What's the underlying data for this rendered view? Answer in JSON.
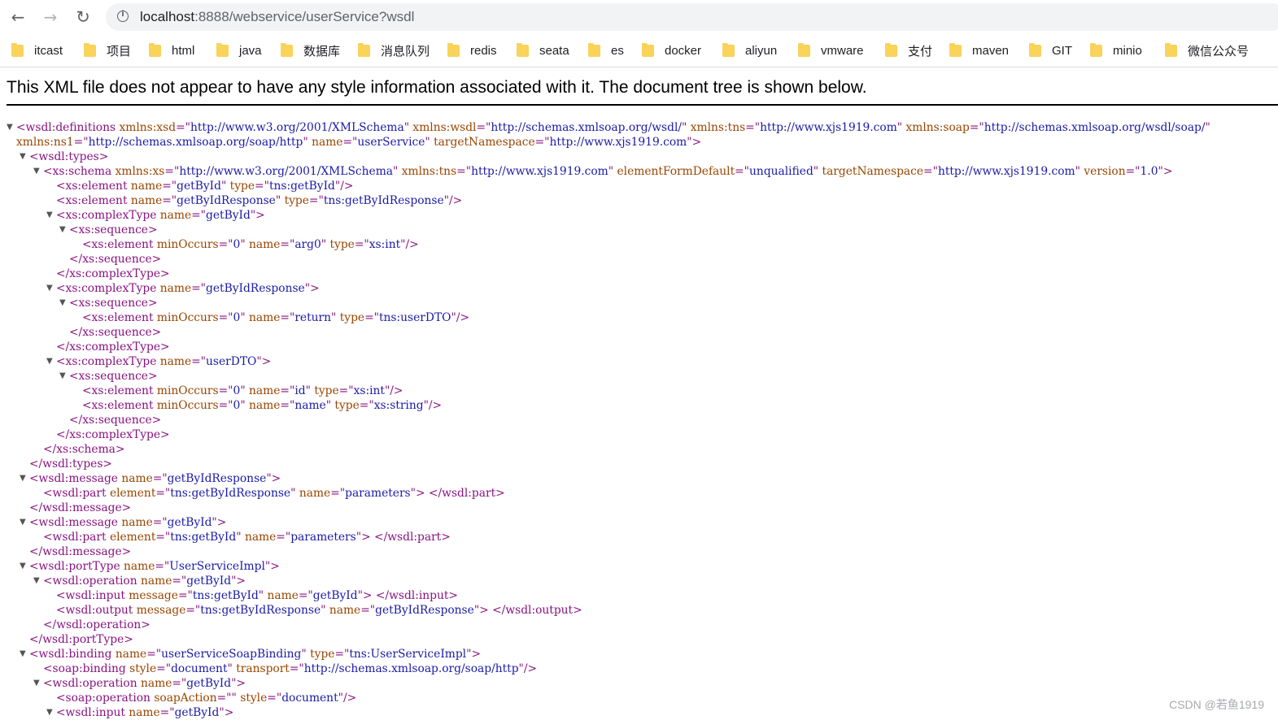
{
  "browser": {
    "url_host": "localhost",
    "url_path": ":8888/webservice/userService?wsdl"
  },
  "bookmarks": [
    "itcast",
    "项目",
    "html",
    "java",
    "数据库",
    "消息队列",
    "redis",
    "seata",
    "es",
    "docker",
    "aliyun",
    "vmware",
    "支付",
    "maven",
    "GIT",
    "minio",
    "微信公众号"
  ],
  "xml_viewer": {
    "notice": "This XML file does not appear to have any style information associated with it. The document tree is shown below.",
    "lines": [
      {
        "toggle": true,
        "tokens": [
          [
            "t",
            "<wsdl:definitions "
          ],
          [
            "n",
            "xmlns:xsd"
          ],
          [
            "t",
            "=\""
          ],
          [
            "v",
            "http://www.w3.org/2001/XMLSchema"
          ],
          [
            "t",
            "\" "
          ],
          [
            "n",
            "xmlns:wsdl"
          ],
          [
            "t",
            "=\""
          ],
          [
            "v",
            "http://schemas.xmlsoap.org/wsdl/"
          ],
          [
            "t",
            "\" "
          ],
          [
            "n",
            "xmlns:tns"
          ],
          [
            "t",
            "=\""
          ],
          [
            "v",
            "http://www.xjs1919.com"
          ],
          [
            "t",
            "\" "
          ],
          [
            "n",
            "xmlns:soap"
          ],
          [
            "t",
            "=\""
          ],
          [
            "v",
            "http://schemas.xmlsoap.org/wsdl/soap/"
          ],
          [
            "t",
            "\""
          ]
        ]
      },
      {
        "toggle": false,
        "tokens": [
          [
            "n",
            "xmlns:ns1"
          ],
          [
            "t",
            "=\""
          ],
          [
            "v",
            "http://schemas.xmlsoap.org/soap/http"
          ],
          [
            "t",
            "\" "
          ],
          [
            "n",
            "name"
          ],
          [
            "t",
            "=\""
          ],
          [
            "v",
            "userService"
          ],
          [
            "t",
            "\" "
          ],
          [
            "n",
            "targetNamespace"
          ],
          [
            "t",
            "=\""
          ],
          [
            "v",
            "http://www.xjs1919.com"
          ],
          [
            "t",
            "\">"
          ]
        ]
      },
      {
        "toggle": true,
        "tokens": [
          [
            "t",
            "<wsdl:types>"
          ]
        ]
      },
      {
        "toggle": true,
        "tokens": [
          [
            "t",
            "<xs:schema "
          ],
          [
            "n",
            "xmlns:xs"
          ],
          [
            "t",
            "=\""
          ],
          [
            "v",
            "http://www.w3.org/2001/XMLSchema"
          ],
          [
            "t",
            "\" "
          ],
          [
            "n",
            "xmlns:tns"
          ],
          [
            "t",
            "=\""
          ],
          [
            "v",
            "http://www.xjs1919.com"
          ],
          [
            "t",
            "\" "
          ],
          [
            "n",
            "elementFormDefault"
          ],
          [
            "t",
            "=\""
          ],
          [
            "v",
            "unqualified"
          ],
          [
            "t",
            "\" "
          ],
          [
            "n",
            "targetNamespace"
          ],
          [
            "t",
            "=\""
          ],
          [
            "v",
            "http://www.xjs1919.com"
          ],
          [
            "t",
            "\" "
          ],
          [
            "n",
            "version"
          ],
          [
            "t",
            "=\""
          ],
          [
            "v",
            "1.0"
          ],
          [
            "t",
            "\">"
          ]
        ]
      },
      {
        "toggle": false,
        "tokens": [
          [
            "t",
            "<xs:element "
          ],
          [
            "n",
            "name"
          ],
          [
            "t",
            "=\""
          ],
          [
            "v",
            "getById"
          ],
          [
            "t",
            "\" "
          ],
          [
            "n",
            "type"
          ],
          [
            "t",
            "=\""
          ],
          [
            "v",
            "tns:getById"
          ],
          [
            "t",
            "\"/>"
          ]
        ]
      },
      {
        "toggle": false,
        "tokens": [
          [
            "t",
            "<xs:element "
          ],
          [
            "n",
            "name"
          ],
          [
            "t",
            "=\""
          ],
          [
            "v",
            "getByIdResponse"
          ],
          [
            "t",
            "\" "
          ],
          [
            "n",
            "type"
          ],
          [
            "t",
            "=\""
          ],
          [
            "v",
            "tns:getByIdResponse"
          ],
          [
            "t",
            "\"/>"
          ]
        ]
      },
      {
        "toggle": true,
        "tokens": [
          [
            "t",
            "<xs:complexType "
          ],
          [
            "n",
            "name"
          ],
          [
            "t",
            "=\""
          ],
          [
            "v",
            "getById"
          ],
          [
            "t",
            "\">"
          ]
        ]
      },
      {
        "toggle": true,
        "tokens": [
          [
            "t",
            "<xs:sequence>"
          ]
        ]
      },
      {
        "toggle": false,
        "tokens": [
          [
            "t",
            "<xs:element "
          ],
          [
            "n",
            "minOccurs"
          ],
          [
            "t",
            "=\""
          ],
          [
            "v",
            "0"
          ],
          [
            "t",
            "\" "
          ],
          [
            "n",
            "name"
          ],
          [
            "t",
            "=\""
          ],
          [
            "v",
            "arg0"
          ],
          [
            "t",
            "\" "
          ],
          [
            "n",
            "type"
          ],
          [
            "t",
            "=\""
          ],
          [
            "v",
            "xs:int"
          ],
          [
            "t",
            "\"/>"
          ]
        ]
      },
      {
        "toggle": false,
        "tokens": [
          [
            "t",
            "</xs:sequence>"
          ]
        ]
      },
      {
        "toggle": false,
        "tokens": [
          [
            "t",
            "</xs:complexType>"
          ]
        ]
      },
      {
        "toggle": true,
        "tokens": [
          [
            "t",
            "<xs:complexType "
          ],
          [
            "n",
            "name"
          ],
          [
            "t",
            "=\""
          ],
          [
            "v",
            "getByIdResponse"
          ],
          [
            "t",
            "\">"
          ]
        ]
      },
      {
        "toggle": true,
        "tokens": [
          [
            "t",
            "<xs:sequence>"
          ]
        ]
      },
      {
        "toggle": false,
        "tokens": [
          [
            "t",
            "<xs:element "
          ],
          [
            "n",
            "minOccurs"
          ],
          [
            "t",
            "=\""
          ],
          [
            "v",
            "0"
          ],
          [
            "t",
            "\" "
          ],
          [
            "n",
            "name"
          ],
          [
            "t",
            "=\""
          ],
          [
            "v",
            "return"
          ],
          [
            "t",
            "\" "
          ],
          [
            "n",
            "type"
          ],
          [
            "t",
            "=\""
          ],
          [
            "v",
            "tns:userDTO"
          ],
          [
            "t",
            "\"/>"
          ]
        ]
      },
      {
        "toggle": false,
        "tokens": [
          [
            "t",
            "</xs:sequence>"
          ]
        ]
      },
      {
        "toggle": false,
        "tokens": [
          [
            "t",
            "</xs:complexType>"
          ]
        ]
      },
      {
        "toggle": true,
        "tokens": [
          [
            "t",
            "<xs:complexType "
          ],
          [
            "n",
            "name"
          ],
          [
            "t",
            "=\""
          ],
          [
            "v",
            "userDTO"
          ],
          [
            "t",
            "\">"
          ]
        ]
      },
      {
        "toggle": true,
        "tokens": [
          [
            "t",
            "<xs:sequence>"
          ]
        ]
      },
      {
        "toggle": false,
        "tokens": [
          [
            "t",
            "<xs:element "
          ],
          [
            "n",
            "minOccurs"
          ],
          [
            "t",
            "=\""
          ],
          [
            "v",
            "0"
          ],
          [
            "t",
            "\" "
          ],
          [
            "n",
            "name"
          ],
          [
            "t",
            "=\""
          ],
          [
            "v",
            "id"
          ],
          [
            "t",
            "\" "
          ],
          [
            "n",
            "type"
          ],
          [
            "t",
            "=\""
          ],
          [
            "v",
            "xs:int"
          ],
          [
            "t",
            "\"/>"
          ]
        ]
      },
      {
        "toggle": false,
        "tokens": [
          [
            "t",
            "<xs:element "
          ],
          [
            "n",
            "minOccurs"
          ],
          [
            "t",
            "=\""
          ],
          [
            "v",
            "0"
          ],
          [
            "t",
            "\" "
          ],
          [
            "n",
            "name"
          ],
          [
            "t",
            "=\""
          ],
          [
            "v",
            "name"
          ],
          [
            "t",
            "\" "
          ],
          [
            "n",
            "type"
          ],
          [
            "t",
            "=\""
          ],
          [
            "v",
            "xs:string"
          ],
          [
            "t",
            "\"/>"
          ]
        ]
      },
      {
        "toggle": false,
        "tokens": [
          [
            "t",
            "</xs:sequence>"
          ]
        ]
      },
      {
        "toggle": false,
        "tokens": [
          [
            "t",
            "</xs:complexType>"
          ]
        ]
      },
      {
        "toggle": false,
        "tokens": [
          [
            "t",
            "</xs:schema>"
          ]
        ]
      },
      {
        "toggle": false,
        "tokens": [
          [
            "t",
            "</wsdl:types>"
          ]
        ]
      },
      {
        "toggle": true,
        "tokens": [
          [
            "t",
            "<wsdl:message "
          ],
          [
            "n",
            "name"
          ],
          [
            "t",
            "=\""
          ],
          [
            "v",
            "getByIdResponse"
          ],
          [
            "t",
            "\">"
          ]
        ]
      },
      {
        "toggle": false,
        "tokens": [
          [
            "t",
            "<wsdl:part "
          ],
          [
            "n",
            "element"
          ],
          [
            "t",
            "=\""
          ],
          [
            "v",
            "tns:getByIdResponse"
          ],
          [
            "t",
            "\" "
          ],
          [
            "n",
            "name"
          ],
          [
            "t",
            "=\""
          ],
          [
            "v",
            "parameters"
          ],
          [
            "t",
            "\"> </wsdl:part>"
          ]
        ]
      },
      {
        "toggle": false,
        "tokens": [
          [
            "t",
            "</wsdl:message>"
          ]
        ]
      },
      {
        "toggle": true,
        "tokens": [
          [
            "t",
            "<wsdl:message "
          ],
          [
            "n",
            "name"
          ],
          [
            "t",
            "=\""
          ],
          [
            "v",
            "getById"
          ],
          [
            "t",
            "\">"
          ]
        ]
      },
      {
        "toggle": false,
        "tokens": [
          [
            "t",
            "<wsdl:part "
          ],
          [
            "n",
            "element"
          ],
          [
            "t",
            "=\""
          ],
          [
            "v",
            "tns:getById"
          ],
          [
            "t",
            "\" "
          ],
          [
            "n",
            "name"
          ],
          [
            "t",
            "=\""
          ],
          [
            "v",
            "parameters"
          ],
          [
            "t",
            "\"> </wsdl:part>"
          ]
        ]
      },
      {
        "toggle": false,
        "tokens": [
          [
            "t",
            "</wsdl:message>"
          ]
        ]
      },
      {
        "toggle": true,
        "tokens": [
          [
            "t",
            "<wsdl:portType "
          ],
          [
            "n",
            "name"
          ],
          [
            "t",
            "=\""
          ],
          [
            "v",
            "UserServiceImpl"
          ],
          [
            "t",
            "\">"
          ]
        ]
      },
      {
        "toggle": true,
        "tokens": [
          [
            "t",
            "<wsdl:operation "
          ],
          [
            "n",
            "name"
          ],
          [
            "t",
            "=\""
          ],
          [
            "v",
            "getById"
          ],
          [
            "t",
            "\">"
          ]
        ]
      },
      {
        "toggle": false,
        "tokens": [
          [
            "t",
            "<wsdl:input "
          ],
          [
            "n",
            "message"
          ],
          [
            "t",
            "=\""
          ],
          [
            "v",
            "tns:getById"
          ],
          [
            "t",
            "\" "
          ],
          [
            "n",
            "name"
          ],
          [
            "t",
            "=\""
          ],
          [
            "v",
            "getById"
          ],
          [
            "t",
            "\"> </wsdl:input>"
          ]
        ]
      },
      {
        "toggle": false,
        "tokens": [
          [
            "t",
            "<wsdl:output "
          ],
          [
            "n",
            "message"
          ],
          [
            "t",
            "=\""
          ],
          [
            "v",
            "tns:getByIdResponse"
          ],
          [
            "t",
            "\" "
          ],
          [
            "n",
            "name"
          ],
          [
            "t",
            "=\""
          ],
          [
            "v",
            "getByIdResponse"
          ],
          [
            "t",
            "\"> </wsdl:output>"
          ]
        ]
      },
      {
        "toggle": false,
        "tokens": [
          [
            "t",
            "</wsdl:operation>"
          ]
        ]
      },
      {
        "toggle": false,
        "tokens": [
          [
            "t",
            "</wsdl:portType>"
          ]
        ]
      },
      {
        "toggle": true,
        "tokens": [
          [
            "t",
            "<wsdl:binding "
          ],
          [
            "n",
            "name"
          ],
          [
            "t",
            "=\""
          ],
          [
            "v",
            "userServiceSoapBinding"
          ],
          [
            "t",
            "\" "
          ],
          [
            "n",
            "type"
          ],
          [
            "t",
            "=\""
          ],
          [
            "v",
            "tns:UserServiceImpl"
          ],
          [
            "t",
            "\">"
          ]
        ]
      },
      {
        "toggle": false,
        "tokens": [
          [
            "t",
            "<soap:binding "
          ],
          [
            "n",
            "style"
          ],
          [
            "t",
            "=\""
          ],
          [
            "v",
            "document"
          ],
          [
            "t",
            "\" "
          ],
          [
            "n",
            "transport"
          ],
          [
            "t",
            "=\""
          ],
          [
            "v",
            "http://schemas.xmlsoap.org/soap/http"
          ],
          [
            "t",
            "\"/>"
          ]
        ]
      },
      {
        "toggle": true,
        "tokens": [
          [
            "t",
            "<wsdl:operation "
          ],
          [
            "n",
            "name"
          ],
          [
            "t",
            "=\""
          ],
          [
            "v",
            "getById"
          ],
          [
            "t",
            "\">"
          ]
        ]
      },
      {
        "toggle": false,
        "tokens": [
          [
            "t",
            "<soap:operation "
          ],
          [
            "n",
            "soapAction"
          ],
          [
            "t",
            "=\""
          ],
          [
            "v",
            ""
          ],
          [
            "t",
            "\" "
          ],
          [
            "n",
            "style"
          ],
          [
            "t",
            "=\""
          ],
          [
            "v",
            "document"
          ],
          [
            "t",
            "\"/>"
          ]
        ]
      },
      {
        "toggle": true,
        "tokens": [
          [
            "t",
            "<wsdl:input "
          ],
          [
            "n",
            "name"
          ],
          [
            "t",
            "=\""
          ],
          [
            "v",
            "getById"
          ],
          [
            "t",
            "\">"
          ]
        ]
      }
    ]
  },
  "watermark": "CSDN @若鱼1919"
}
